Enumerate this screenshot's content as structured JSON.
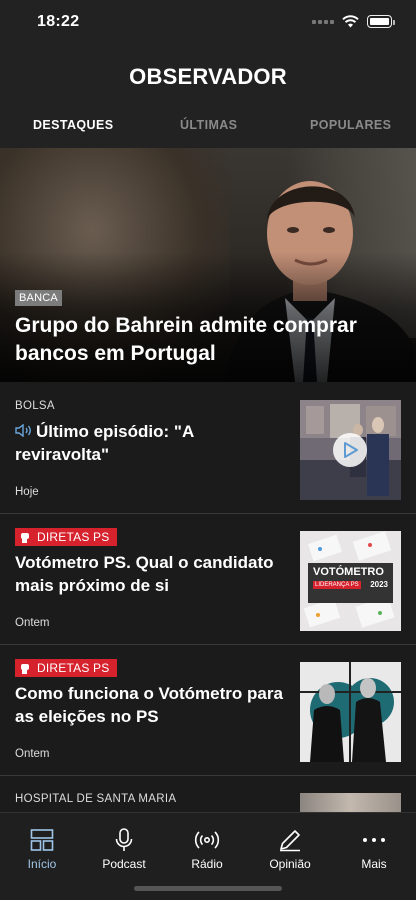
{
  "status": {
    "time": "18:22"
  },
  "header": {
    "logo": "OBSERVADOR"
  },
  "tabs": [
    {
      "label": "DESTAQUES",
      "active": true
    },
    {
      "label": "ÚLTIMAS",
      "active": false
    },
    {
      "label": "POPULARES",
      "active": false
    }
  ],
  "hero": {
    "badge": "BANCA",
    "title": "Grupo do Bahrein admite comprar bancos em Portugal"
  },
  "articles": [
    {
      "tag": "BOLSA",
      "title": "Último episódio: \"A reviravolta\"",
      "time": "Hoje",
      "podcast": true,
      "thumb": "video-thumbnail"
    },
    {
      "tag": "DIRETAS PS",
      "live": true,
      "title": "Votómetro PS. Qual o candidato mais próximo de si",
      "time": "Ontem",
      "thumb_text": {
        "line1": "VOTÓMETRO",
        "line2": "LIDERANÇA PS",
        "line3": "2023"
      }
    },
    {
      "tag": "DIRETAS PS",
      "live": true,
      "title": "Como funciona o Votómetro para as eleições no PS",
      "time": "Ontem",
      "thumb": "candidates-photo"
    },
    {
      "tag": "HOSPITAL DE SANTA MARIA"
    }
  ],
  "tabbar": [
    {
      "label": "Início",
      "icon": "home-grid-icon",
      "active": true
    },
    {
      "label": "Podcast",
      "icon": "microphone-icon",
      "active": false
    },
    {
      "label": "Rádio",
      "icon": "radio-icon",
      "active": false
    },
    {
      "label": "Opinião",
      "icon": "pen-icon",
      "active": false
    },
    {
      "label": "Mais",
      "icon": "more-icon",
      "active": false
    }
  ],
  "colors": {
    "accent_red": "#d6222d",
    "active_tab": "#9fc6e8",
    "background": "#1b1b1b"
  }
}
